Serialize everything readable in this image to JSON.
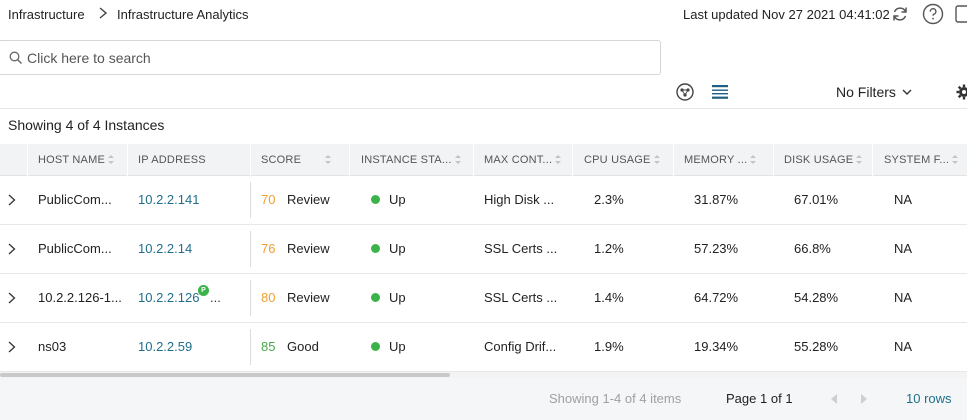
{
  "breadcrumb": {
    "root": "Infrastructure",
    "current": "Infrastructure Analytics"
  },
  "header": {
    "last_updated": "Last updated Nov 27 2021 04:41:02",
    "icons": [
      "refresh-icon",
      "help-icon",
      "window-icon"
    ]
  },
  "search": {
    "placeholder": "Click here to search",
    "value": ""
  },
  "toolbar": {
    "view_icons": [
      "topology-view-icon",
      "list-view-icon"
    ],
    "filters_label": "No Filters",
    "settings_icon": "gear-icon"
  },
  "summary": "Showing 4 of 4 Instances",
  "table": {
    "columns": [
      "HOST NAME",
      "IP ADDRESS",
      "SCORE",
      "INSTANCE STA...",
      "MAX CONT...",
      "CPU USAGE",
      "MEMORY ...",
      "DISK USAGE",
      "SYSTEM F..."
    ],
    "rows": [
      {
        "host": "PublicCom...",
        "ip": "10.2.2.141",
        "score": "70",
        "score_label": "Review",
        "status": "Up",
        "max_cont": "High Disk ...",
        "cpu": "2.3%",
        "memory": "31.87%",
        "disk": "67.01%",
        "system": "NA"
      },
      {
        "host": "PublicCom...",
        "ip": "10.2.2.14",
        "score": "76",
        "score_label": "Review",
        "status": "Up",
        "max_cont": "SSL Certs ...",
        "cpu": "1.2%",
        "memory": "57.23%",
        "disk": "66.8%",
        "system": "NA"
      },
      {
        "host": "10.2.2.126-1...",
        "ip": "10.2.2.126",
        "ip_badge": "P",
        "ip_suffix": "...",
        "score": "80",
        "score_label": "Review",
        "status": "Up",
        "max_cont": "SSL Certs ...",
        "cpu": "1.4%",
        "memory": "64.72%",
        "disk": "54.28%",
        "system": "NA"
      },
      {
        "host": "ns03",
        "ip": "10.2.2.59",
        "score": "85",
        "score_label": "Good",
        "status": "Up",
        "max_cont": "Config Drif...",
        "cpu": "1.9%",
        "memory": "19.34%",
        "disk": "55.28%",
        "system": "NA"
      }
    ]
  },
  "colors": {
    "link": "#1f6f8b",
    "score_review": "#f0a030",
    "score_good": "#4aa84a",
    "status_up": "#3bb34a"
  },
  "pagination": {
    "showing": "Showing 1-4 of 4 items",
    "page_word": "Page",
    "page": "1",
    "of_word": "of",
    "total_pages": "1",
    "rows_per_page": "10 rows"
  }
}
